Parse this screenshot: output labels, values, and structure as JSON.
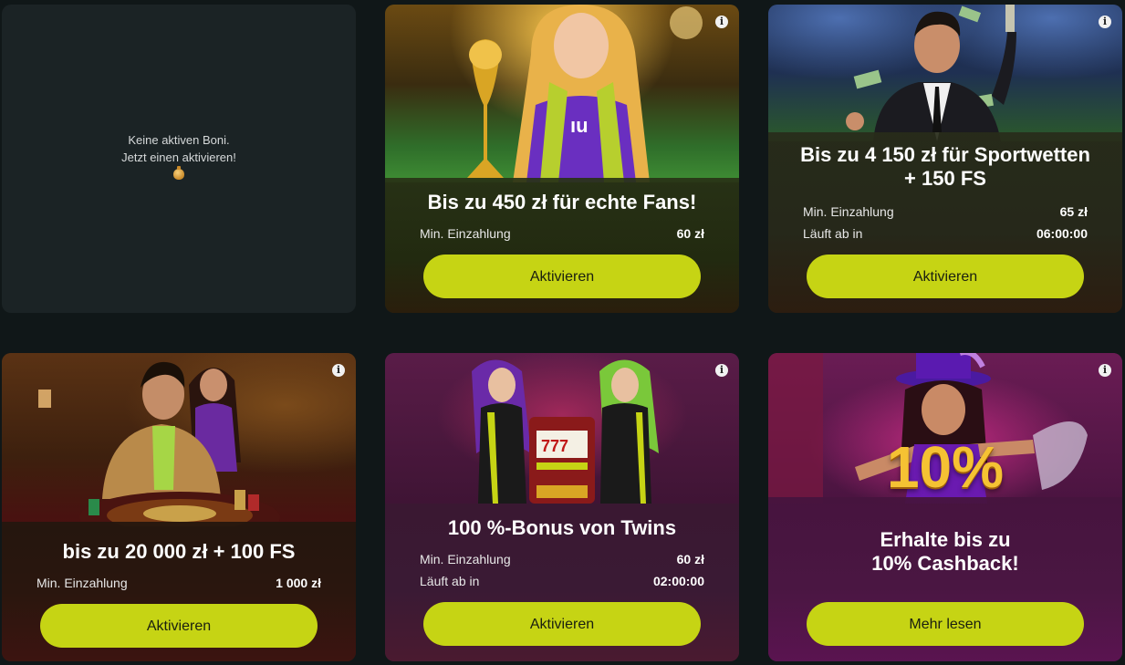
{
  "empty_state": {
    "line1": "Keine aktiven Boni.",
    "line2": "Jetzt einen aktivieren!",
    "icon": "money-bag-icon"
  },
  "bonuses": [
    {
      "title": "Bis zu 450 zł für echte Fans!",
      "rows": [
        {
          "label": "Min. Einzahlung",
          "value": "60 zł"
        }
      ],
      "button": "Aktivieren"
    },
    {
      "title_line1": "Bis zu 4 150 zł für Sportwetten",
      "title_line2": "+ 150 FS",
      "rows": [
        {
          "label": "Min. Einzahlung",
          "value": "65 zł"
        },
        {
          "label": "Läuft ab in",
          "value": "06:00:00"
        }
      ],
      "button": "Aktivieren"
    },
    {
      "title": "bis zu 20 000 zł + 100 FS",
      "rows": [
        {
          "label": "Min. Einzahlung",
          "value": "1 000 zł"
        }
      ],
      "button": "Aktivieren"
    },
    {
      "title": "100 %-Bonus von Twins",
      "rows": [
        {
          "label": "Min. Einzahlung",
          "value": "60 zł"
        },
        {
          "label": "Läuft ab in",
          "value": "02:00:00"
        }
      ],
      "button": "Aktivieren"
    },
    {
      "title_line1": "Erhalte bis zu",
      "title_line2": "10% Cashback!",
      "rows": [],
      "button": "Mehr lesen",
      "art_text": "10%"
    }
  ],
  "info_glyph": "i",
  "colors": {
    "accent": "#c6d414",
    "background": "#101718",
    "empty_card": "#1b2325"
  }
}
